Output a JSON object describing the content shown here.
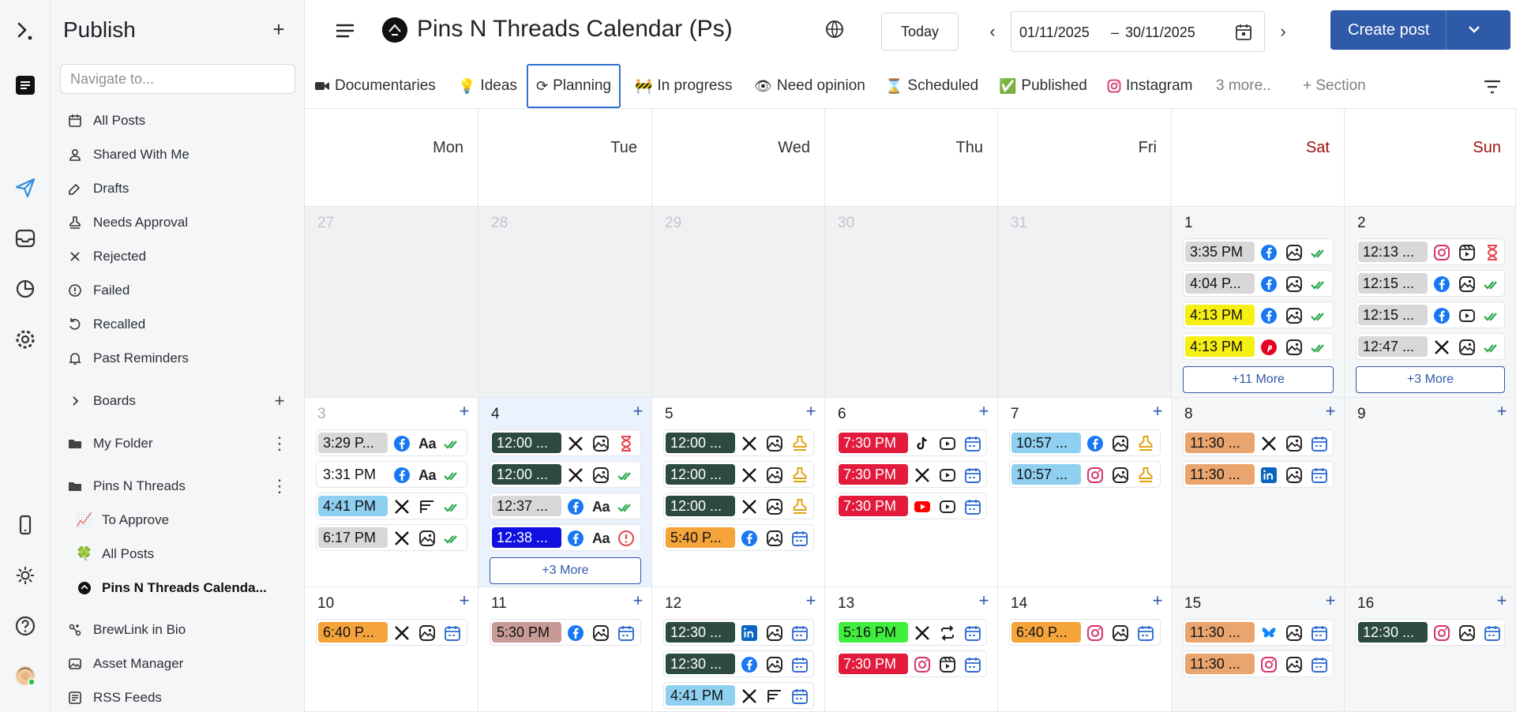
{
  "sidebar": {
    "title": "Publish",
    "search_placeholder": "Navigate to...",
    "items": [
      {
        "label": "All Posts",
        "icon": "calendar-icon"
      },
      {
        "label": "Shared With Me",
        "icon": "user-icon"
      },
      {
        "label": "Drafts",
        "icon": "drafts-icon"
      },
      {
        "label": "Needs Approval",
        "icon": "stamp-icon"
      },
      {
        "label": "Rejected",
        "icon": "x-icon"
      },
      {
        "label": "Failed",
        "icon": "alert-icon"
      },
      {
        "label": "Recalled",
        "icon": "undo-icon"
      },
      {
        "label": "Past Reminders",
        "icon": "bell-icon"
      }
    ],
    "boards_label": "Boards",
    "folders": [
      {
        "label": "My Folder"
      },
      {
        "label": "Pins N Threads"
      }
    ],
    "sub_items": [
      {
        "label": "To Approve",
        "glyph": "📈"
      },
      {
        "label": "All Posts",
        "glyph": "🍀"
      },
      {
        "label": "Pins N Threads Calenda...",
        "glyph": "●"
      }
    ],
    "bottom_items": [
      {
        "label": "BrewLink in Bio",
        "icon": "link-icon"
      },
      {
        "label": "Asset Manager",
        "icon": "image-icon"
      },
      {
        "label": "RSS Feeds",
        "icon": "rss-icon"
      }
    ]
  },
  "header": {
    "title": "Pins N Threads Calendar (Ps)",
    "today": "Today",
    "date_from": "01/11/2025",
    "date_sep": "–",
    "date_to": "30/11/2025",
    "create": "Create post"
  },
  "tabs": [
    {
      "label": "Documentaries",
      "glyph": "📹"
    },
    {
      "label": "Ideas",
      "glyph": "💡"
    },
    {
      "label": "Planning",
      "glyph": "⟳",
      "active": true
    },
    {
      "label": "In progress",
      "glyph": "🚧"
    },
    {
      "label": "Need opinion",
      "glyph": "👁"
    },
    {
      "label": "Scheduled",
      "glyph": "⌛"
    },
    {
      "label": "Published",
      "glyph": "✅"
    },
    {
      "label": "Instagram",
      "glyph": "◎"
    },
    {
      "label": "3 more..",
      "glyph": ""
    },
    {
      "label": "+ Section",
      "glyph": ""
    }
  ],
  "calendar": {
    "weekdays": [
      "Mon",
      "Tue",
      "Wed",
      "Thu",
      "Fri",
      "Sat",
      "Sun"
    ],
    "colors": {
      "dark": "#2c4a40",
      "gray": "#d8d8d8",
      "yellow": "#f5ef13",
      "blue": "#8fd0f0",
      "orange": "#f5a43c",
      "red": "#e21b3c",
      "pink": "#c89a96",
      "green": "#3fee3f",
      "royal": "#1010e0",
      "peach": "#eaa56e"
    },
    "weeks": [
      [
        {
          "day": "27",
          "out": true,
          "posts": []
        },
        {
          "day": "28",
          "out": true,
          "posts": []
        },
        {
          "day": "29",
          "out": true,
          "posts": []
        },
        {
          "day": "30",
          "out": true,
          "posts": []
        },
        {
          "day": "31",
          "out": true,
          "posts": []
        },
        {
          "day": "1",
          "wkend": true,
          "posts": [
            {
              "time": "3:35 PM",
              "bg": "gray",
              "icons": [
                "facebook",
                "image",
                "check"
              ]
            },
            {
              "time": "4:04 P...",
              "bg": "gray",
              "icons": [
                "facebook",
                "image",
                "check"
              ]
            },
            {
              "time": "4:13 PM",
              "bg": "yellow",
              "icons": [
                "facebook",
                "image",
                "check"
              ]
            },
            {
              "time": "4:13 PM",
              "bg": "yellow",
              "icons": [
                "pinterest",
                "image",
                "check"
              ]
            }
          ],
          "more": "+11 More"
        },
        {
          "day": "2",
          "wkend": true,
          "posts": [
            {
              "time": "12:13 ...",
              "bg": "gray",
              "icons": [
                "instagram",
                "reel",
                "hourglass"
              ]
            },
            {
              "time": "12:15 ...",
              "bg": "gray",
              "icons": [
                "facebook",
                "image",
                "check"
              ]
            },
            {
              "time": "12:15 ...",
              "bg": "gray",
              "icons": [
                "facebook",
                "video",
                "check"
              ]
            },
            {
              "time": "12:47 ...",
              "bg": "gray",
              "icons": [
                "x",
                "image",
                "check"
              ]
            }
          ],
          "more": "+3 More"
        }
      ],
      [
        {
          "day": "3",
          "faint": true,
          "posts": [
            {
              "time": "3:29 P...",
              "bg": "gray",
              "icons": [
                "facebook",
                "text",
                "check"
              ]
            },
            {
              "time": "3:31 PM",
              "bg": "white",
              "icons": [
                "facebook",
                "text",
                "check"
              ]
            },
            {
              "time": "4:41 PM",
              "bg": "blue",
              "icons": [
                "x",
                "thread",
                "check"
              ]
            },
            {
              "time": "6:17 PM",
              "bg": "gray",
              "icons": [
                "x",
                "image",
                "check"
              ]
            }
          ]
        },
        {
          "day": "4",
          "today": true,
          "posts": [
            {
              "time": "12:00 ...",
              "bg": "dark",
              "icons": [
                "x",
                "image",
                "hourglass"
              ]
            },
            {
              "time": "12:00 ...",
              "bg": "dark",
              "icons": [
                "x",
                "image",
                "check"
              ]
            },
            {
              "time": "12:37 ...",
              "bg": "gray",
              "icons": [
                "facebook",
                "text",
                "check"
              ]
            },
            {
              "time": "12:38 ...",
              "bg": "royal",
              "icons": [
                "facebook",
                "text",
                "error"
              ]
            }
          ],
          "more": "+3 More"
        },
        {
          "day": "5",
          "posts": [
            {
              "time": "12:00 ...",
              "bg": "dark",
              "icons": [
                "x",
                "image",
                "stamp"
              ]
            },
            {
              "time": "12:00 ...",
              "bg": "dark",
              "icons": [
                "x",
                "image",
                "stamp"
              ]
            },
            {
              "time": "12:00 ...",
              "bg": "dark",
              "icons": [
                "x",
                "image",
                "stamp"
              ]
            },
            {
              "time": "5:40 P...",
              "bg": "orange",
              "icons": [
                "facebook",
                "image",
                "schedule"
              ]
            }
          ]
        },
        {
          "day": "6",
          "posts": [
            {
              "time": "7:30 PM",
              "bg": "red",
              "icons": [
                "tiktok",
                "video",
                "schedule"
              ]
            },
            {
              "time": "7:30 PM",
              "bg": "red",
              "icons": [
                "x",
                "video",
                "schedule"
              ]
            },
            {
              "time": "7:30 PM",
              "bg": "red",
              "icons": [
                "youtube",
                "video",
                "schedule"
              ]
            }
          ]
        },
        {
          "day": "7",
          "posts": [
            {
              "time": "10:57 ...",
              "bg": "blue",
              "icons": [
                "facebook",
                "image",
                "stamp"
              ]
            },
            {
              "time": "10:57 ...",
              "bg": "blue",
              "icons": [
                "instagram",
                "image",
                "stamp"
              ]
            }
          ]
        },
        {
          "day": "8",
          "wkend": true,
          "posts": [
            {
              "time": "11:30 ...",
              "bg": "peach",
              "icons": [
                "x",
                "image",
                "schedule"
              ]
            },
            {
              "time": "11:30 ...",
              "bg": "peach",
              "icons": [
                "linkedin",
                "image",
                "schedule"
              ]
            }
          ]
        },
        {
          "day": "9",
          "wkend": true,
          "posts": []
        }
      ],
      [
        {
          "day": "10",
          "posts": [
            {
              "time": "6:40 P...",
              "bg": "orange",
              "icons": [
                "x",
                "image",
                "schedule"
              ]
            }
          ]
        },
        {
          "day": "11",
          "posts": [
            {
              "time": "5:30 PM",
              "bg": "pink",
              "icons": [
                "facebook",
                "image",
                "schedule"
              ]
            }
          ]
        },
        {
          "day": "12",
          "posts": [
            {
              "time": "12:30 ...",
              "bg": "dark",
              "icons": [
                "linkedin",
                "image",
                "schedule"
              ]
            },
            {
              "time": "12:30 ...",
              "bg": "dark",
              "icons": [
                "facebook",
                "image",
                "schedule"
              ]
            },
            {
              "time": "4:41 PM",
              "bg": "blue",
              "icons": [
                "x",
                "thread",
                "schedule"
              ]
            }
          ]
        },
        {
          "day": "13",
          "posts": [
            {
              "time": "5:16 PM",
              "bg": "green",
              "icons": [
                "x",
                "repost",
                "schedule"
              ]
            },
            {
              "time": "7:30 PM",
              "bg": "red",
              "icons": [
                "instagram",
                "reel",
                "schedule"
              ]
            }
          ]
        },
        {
          "day": "14",
          "posts": [
            {
              "time": "6:40 P...",
              "bg": "orange",
              "icons": [
                "instagram",
                "image",
                "schedule"
              ]
            }
          ]
        },
        {
          "day": "15",
          "wkend": true,
          "posts": [
            {
              "time": "11:30 ...",
              "bg": "peach",
              "icons": [
                "bluesky",
                "image",
                "schedule"
              ]
            },
            {
              "time": "11:30 ...",
              "bg": "peach",
              "icons": [
                "instagram",
                "image",
                "schedule"
              ]
            }
          ]
        },
        {
          "day": "16",
          "wkend": true,
          "posts": [
            {
              "time": "12:30 ...",
              "bg": "dark",
              "icons": [
                "instagram",
                "image",
                "schedule"
              ]
            }
          ]
        }
      ]
    ]
  }
}
